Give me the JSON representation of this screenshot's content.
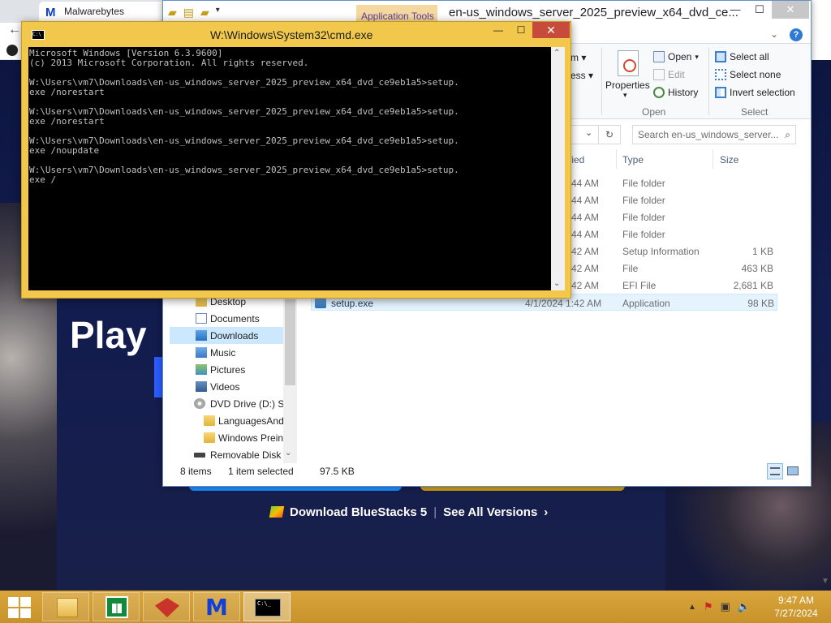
{
  "browser": {
    "tab_title": "Malwarebytes",
    "hero_title": "Play",
    "download_label": "Download BlueStacks 5",
    "separator": "|",
    "versions_label": "See All Versions",
    "versions_chevron": "›"
  },
  "explorer": {
    "app_tools_label": "Application Tools",
    "title": "en-us_windows_server_2025_preview_x64_dvd_ce...",
    "window_buttons": [
      "—",
      "☐",
      "✕"
    ],
    "ribbon": {
      "partial_items": [
        "m ▾",
        "cess ▾"
      ],
      "properties_label": "Properties",
      "open_label": "Open",
      "edit_label": "Edit",
      "history_label": "History",
      "open_group": "Open",
      "select_all_label": "Select all",
      "select_none_label": "Select none",
      "invert_selection_label": "Invert selection",
      "select_group": "Select"
    },
    "search_placeholder": "Search en-us_windows_server...",
    "columns": {
      "modified_partial": "fied",
      "type": "Type",
      "size": "Size"
    },
    "files": [
      {
        "date": "44 AM",
        "type": "File folder",
        "size": ""
      },
      {
        "date": "44 AM",
        "type": "File folder",
        "size": ""
      },
      {
        "date": "44 AM",
        "type": "File folder",
        "size": ""
      },
      {
        "date": "44 AM",
        "type": "File folder",
        "size": ""
      },
      {
        "date": "42 AM",
        "type": "Setup Information",
        "size": "1 KB"
      },
      {
        "date": "42 AM",
        "type": "File",
        "size": "463 KB"
      },
      {
        "date": "42 AM",
        "type": "EFI File",
        "size": "2,681 KB"
      }
    ],
    "selected_file": {
      "name": "setup.exe",
      "date": "4/1/2024 1:42 AM",
      "type": "Application",
      "size": "98 KB"
    },
    "nav_items": [
      {
        "label": "Desktop",
        "icon": "desktop-icon"
      },
      {
        "label": "Documents",
        "icon": "documents-icon"
      },
      {
        "label": "Downloads",
        "icon": "downloads-icon"
      },
      {
        "label": "Music",
        "icon": "music-icon"
      },
      {
        "label": "Pictures",
        "icon": "pictures-icon"
      },
      {
        "label": "Videos",
        "icon": "videos-icon"
      },
      {
        "label": "DVD Drive (D:) SE",
        "icon": "dvd-drive-icon"
      },
      {
        "label": "LanguagesAnd",
        "icon": "folder-icon"
      },
      {
        "label": "Windows Prein",
        "icon": "folder-icon"
      },
      {
        "label": "Removable Disk (",
        "icon": "removable-disk-icon"
      }
    ],
    "status": {
      "items_count": "8 items",
      "selected": "1 item selected",
      "selected_size": "97.5 KB"
    }
  },
  "cmd": {
    "title": "W:\\Windows\\System32\\cmd.exe",
    "window_buttons": [
      "—",
      "☐",
      "✕"
    ],
    "output": "Microsoft Windows [Version 6.3.9600]\n(c) 2013 Microsoft Corporation. All rights reserved.\n\nW:\\Users\\vm7\\Downloads\\en-us_windows_server_2025_preview_x64_dvd_ce9eb1a5>setup.\nexe /norestart\n\nW:\\Users\\vm7\\Downloads\\en-us_windows_server_2025_preview_x64_dvd_ce9eb1a5>setup.\nexe /norestart\n\nW:\\Users\\vm7\\Downloads\\en-us_windows_server_2025_preview_x64_dvd_ce9eb1a5>setup.\nexe /noupdate\n\nW:\\Users\\vm7\\Downloads\\en-us_windows_server_2025_preview_x64_dvd_ce9eb1a5>setup.\nexe /"
  },
  "taskbar": {
    "apps": [
      "file-explorer-icon",
      "store-icon",
      "app-icon",
      "malwarebytes-icon",
      "cmd-icon"
    ],
    "time": "9:47 AM",
    "date": "7/27/2024"
  },
  "colors": {
    "taskbar": "#c7922a",
    "cmd_frame": "#f1c84c",
    "close_red": "#c74b3b",
    "selection": "#e5f3ff"
  }
}
